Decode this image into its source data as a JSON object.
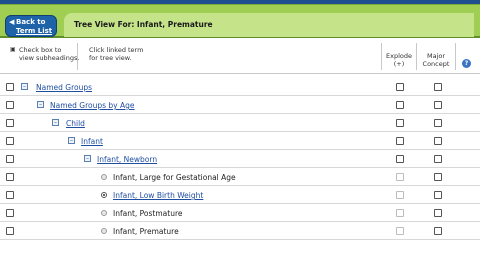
{
  "header": {
    "back_line1": "Back to",
    "back_line2": "Term List",
    "title": "Tree View For: Infant, Premature"
  },
  "columns": {
    "check_hint_1": "Check box to",
    "check_hint_2": "view subheadings.",
    "link_hint_1": "Click linked term",
    "link_hint_2": "for tree view.",
    "explode_1": "Explode",
    "explode_2": "(+)",
    "major_1": "Major",
    "major_2": "Concept",
    "help_glyph": "?"
  },
  "rows": [
    {
      "label": "Named Groups",
      "link": true,
      "toggle": "minus",
      "level": 0
    },
    {
      "label": "Named Groups by Age",
      "link": true,
      "toggle": "minus",
      "level": 1
    },
    {
      "label": "Child",
      "link": true,
      "toggle": "minus",
      "level": 2
    },
    {
      "label": "Infant",
      "link": true,
      "toggle": "minus",
      "level": 3
    },
    {
      "label": "Infant, Newborn",
      "link": true,
      "toggle": "minus",
      "level": 4
    },
    {
      "label": "Infant, Large for Gestational Age",
      "link": false,
      "toggle": "dot",
      "level": 5
    },
    {
      "label": "Infant, Low Birth Weight",
      "link": true,
      "toggle": "dot-selected",
      "level": 5
    },
    {
      "label": "Infant, Postmature",
      "link": false,
      "toggle": "dot",
      "level": 5
    },
    {
      "label": "Infant, Premature",
      "link": false,
      "toggle": "dot",
      "level": 5
    }
  ]
}
